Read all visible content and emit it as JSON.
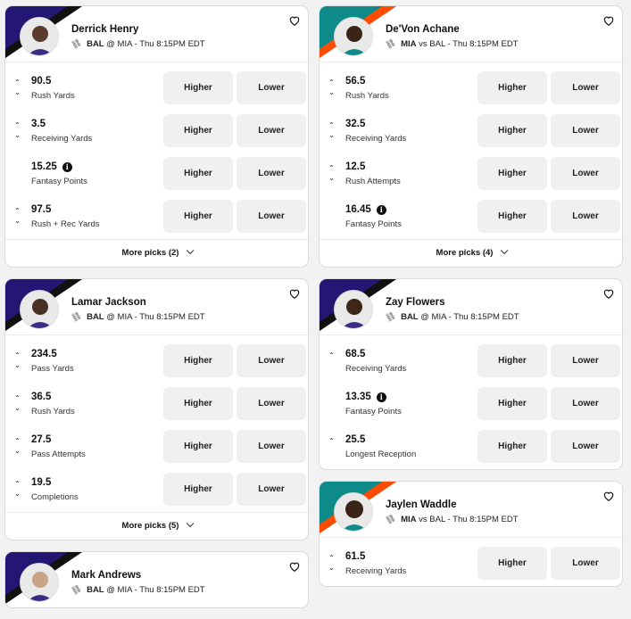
{
  "buttons": {
    "higher": "Higher",
    "lower": "Lower"
  },
  "colors": {
    "ravens": "#241773",
    "dolphins": "#0e8a8a",
    "accent_ravens": "#111111",
    "accent_dolphins": "#fc4c02"
  },
  "cards": {
    "henry": {
      "name": "Derrick Henry",
      "team": "BAL",
      "sep": "@",
      "opp": "MIA",
      "time": "- Thu 8:15PM EDT",
      "lines": [
        {
          "value": "90.5",
          "stat": "Rush Yards"
        },
        {
          "value": "3.5",
          "stat": "Receiving Yards"
        },
        {
          "value": "15.25",
          "stat": "Fantasy Points"
        },
        {
          "value": "97.5",
          "stat": "Rush + Rec Yards"
        }
      ],
      "more": "More picks (2)"
    },
    "achane": {
      "name": "De'Von Achane",
      "team": "MIA",
      "sep": "vs",
      "opp": "BAL",
      "time": "- Thu 8:15PM EDT",
      "lines": [
        {
          "value": "56.5",
          "stat": "Rush Yards"
        },
        {
          "value": "32.5",
          "stat": "Receiving Yards"
        },
        {
          "value": "12.5",
          "stat": "Rush Attempts"
        },
        {
          "value": "16.45",
          "stat": "Fantasy Points"
        }
      ],
      "more": "More picks (4)"
    },
    "jackson": {
      "name": "Lamar Jackson",
      "team": "BAL",
      "sep": "@",
      "opp": "MIA",
      "time": "- Thu 8:15PM EDT",
      "lines": [
        {
          "value": "234.5",
          "stat": "Pass Yards"
        },
        {
          "value": "36.5",
          "stat": "Rush Yards"
        },
        {
          "value": "27.5",
          "stat": "Pass Attempts"
        },
        {
          "value": "19.5",
          "stat": "Completions"
        }
      ],
      "more": "More picks (5)"
    },
    "flowers": {
      "name": "Zay Flowers",
      "team": "BAL",
      "sep": "@",
      "opp": "MIA",
      "time": "- Thu 8:15PM EDT",
      "lines": [
        {
          "value": "68.5",
          "stat": "Receiving Yards"
        },
        {
          "value": "13.35",
          "stat": "Fantasy Points"
        },
        {
          "value": "25.5",
          "stat": "Longest Reception"
        }
      ]
    },
    "waddle": {
      "name": "Jaylen Waddle",
      "team": "MIA",
      "sep": "vs",
      "opp": "BAL",
      "time": "- Thu 8:15PM EDT",
      "lines": [
        {
          "value": "61.5",
          "stat": "Receiving Yards"
        }
      ]
    },
    "andrews": {
      "name": "Mark Andrews",
      "team": "BAL",
      "sep": "@",
      "opp": "MIA",
      "time": "- Thu 8:15PM EDT"
    }
  }
}
